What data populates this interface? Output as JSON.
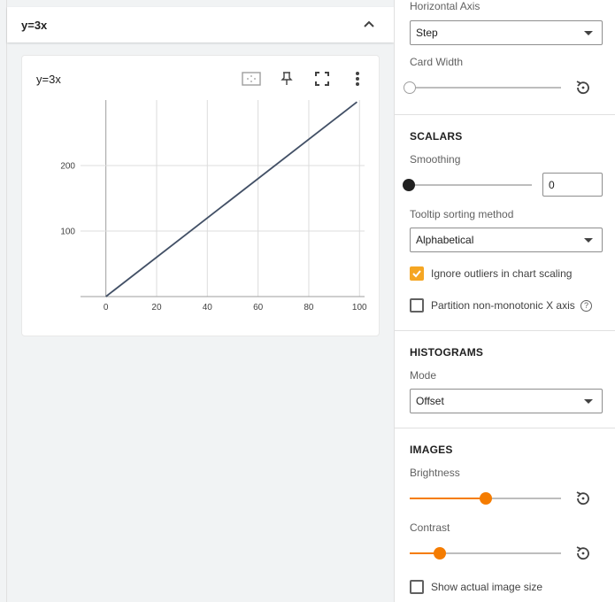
{
  "group": {
    "title": "y=3x"
  },
  "card": {
    "title": "y=3x"
  },
  "chart_data": {
    "type": "line",
    "title": "y=3x",
    "xlabel": "",
    "ylabel": "",
    "x_ticks": [
      "0",
      "20",
      "40",
      "60",
      "80",
      "100"
    ],
    "y_ticks": [
      "100",
      "200"
    ],
    "xlim": [
      -10,
      102
    ],
    "ylim": [
      0,
      300
    ],
    "series": [
      {
        "x": [
          0,
          99
        ],
        "y": [
          0,
          297
        ],
        "color": "#425066"
      }
    ],
    "grid": true
  },
  "settings": {
    "horizontal_axis": {
      "label": "Horizontal Axis",
      "value": "Step"
    },
    "card_width": {
      "label": "Card Width",
      "value": 0
    },
    "scalars": {
      "title": "SCALARS",
      "smoothing_label": "Smoothing",
      "smoothing_value": "0",
      "tooltip_label": "Tooltip sorting method",
      "tooltip_value": "Alphabetical",
      "ignore_outliers_label": "Ignore outliers in chart scaling",
      "ignore_outliers_checked": true,
      "partition_label": "Partition non-monotonic X axis",
      "partition_checked": false
    },
    "histograms": {
      "title": "HISTOGRAMS",
      "mode_label": "Mode",
      "mode_value": "Offset"
    },
    "images": {
      "title": "IMAGES",
      "brightness_label": "Brightness",
      "brightness_value": 0.5,
      "contrast_label": "Contrast",
      "contrast_value": 0.2,
      "actual_size_label": "Show actual image size",
      "actual_size_checked": false
    }
  },
  "colors": {
    "accent": "#f57c00",
    "checkbox": "#f5a623",
    "line": "#425066"
  }
}
